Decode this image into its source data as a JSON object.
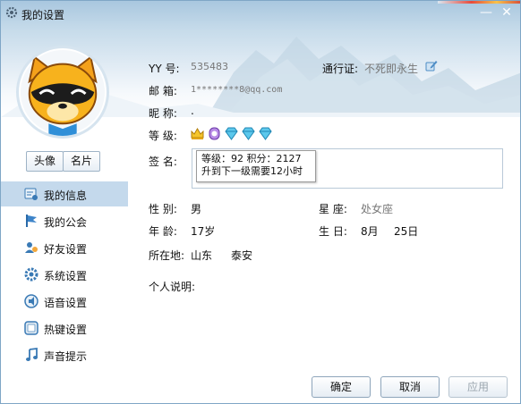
{
  "window": {
    "title": "我的设置",
    "minimize_glyph": "—",
    "close_glyph": "✕"
  },
  "profile_buttons": {
    "avatar_label": "头像",
    "card_label": "名片"
  },
  "sidebar": {
    "items": [
      {
        "label": "我的信息",
        "icon": "my-info-icon",
        "active": true
      },
      {
        "label": "我的公会",
        "icon": "guild-flag-icon",
        "active": false
      },
      {
        "label": "好友设置",
        "icon": "friends-icon",
        "active": false
      },
      {
        "label": "系统设置",
        "icon": "system-gear-icon",
        "active": false
      },
      {
        "label": "语音设置",
        "icon": "voice-icon",
        "active": false
      },
      {
        "label": "热键设置",
        "icon": "hotkey-icon",
        "active": false
      },
      {
        "label": "声音提示",
        "icon": "music-note-icon",
        "active": false
      }
    ]
  },
  "info": {
    "yy_label": "YY 号:",
    "yy_value": "535483",
    "passport_label": "通行证:",
    "passport_value": "不死即永生",
    "email_label": "邮 箱:",
    "email_value": "1********8@qq.com",
    "nickname_label": "昵 称:",
    "nickname_value": ".",
    "level_label": "等 级:",
    "level_icons": [
      "crown-icon",
      "purple-badge-icon",
      "diamond-icon",
      "diamond-icon",
      "diamond-icon"
    ],
    "signature_label": "签 名:",
    "tooltip_line1": "等级：92 积分：2127",
    "tooltip_line2": "升到下一级需要12小时",
    "gender_label": "性 别:",
    "gender_value": "男",
    "constellation_label": "星 座:",
    "constellation_value": "处女座",
    "age_label": "年 龄:",
    "age_value": "17岁",
    "birthday_label": "生 日:",
    "birthday_month": "8月",
    "birthday_day": "25日",
    "location_label": "所在地:",
    "province_value": "山东",
    "city_value": "泰安",
    "bio_label": "个人说明:"
  },
  "footer": {
    "ok_label": "确定",
    "cancel_label": "取消",
    "apply_label": "应用"
  },
  "colors": {
    "accent": "#c4d9ec",
    "sky_top": "#a9c7df",
    "border": "#7fa6c6",
    "link_gray": "#777777"
  }
}
